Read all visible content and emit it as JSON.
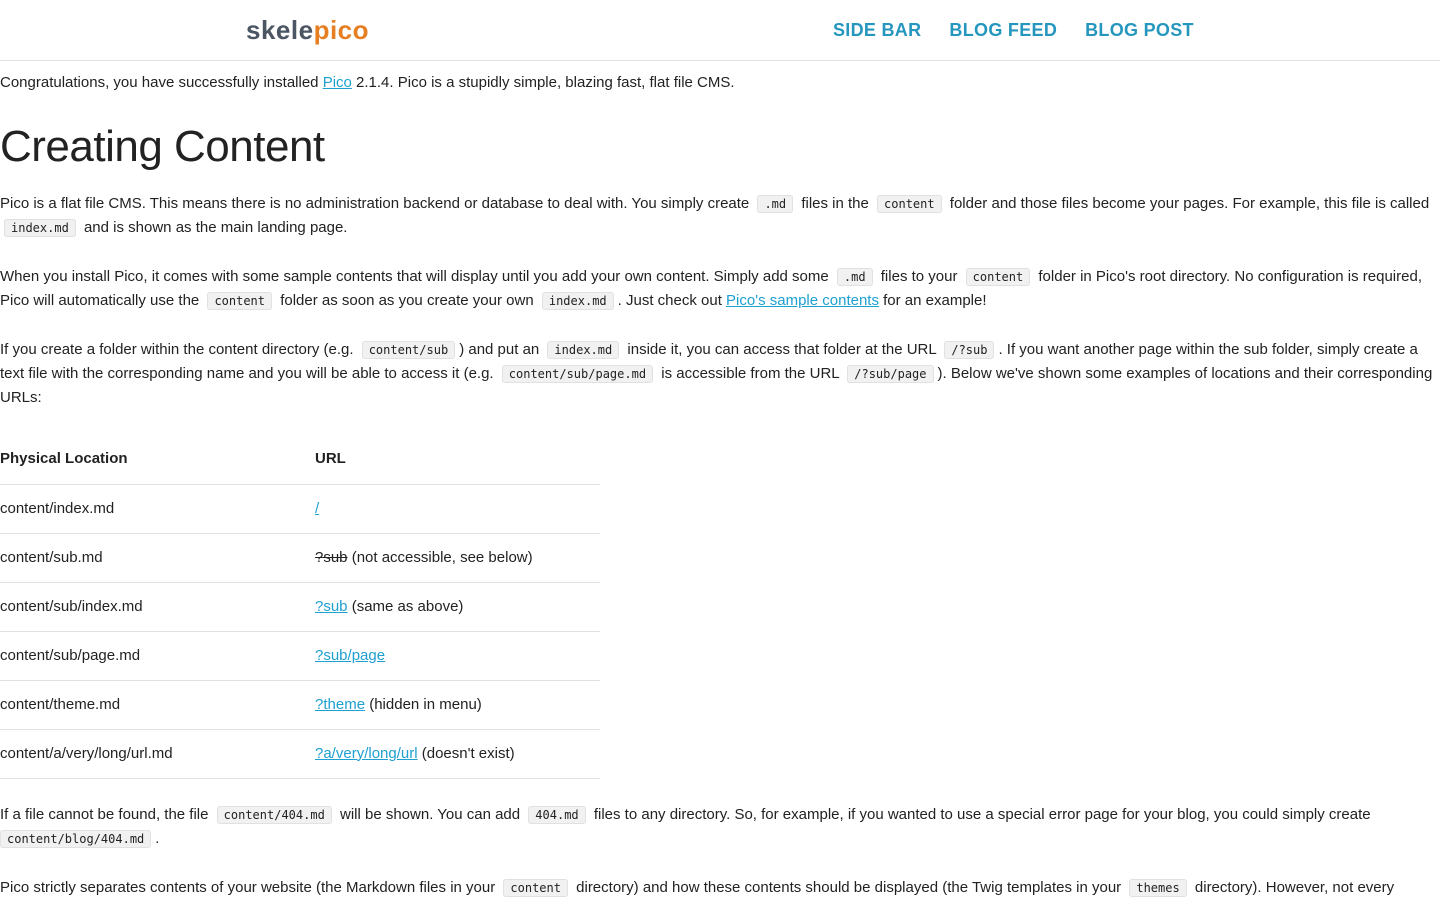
{
  "header": {
    "logo_part1": "skele",
    "logo_part2": "pico",
    "nav": [
      "SIDE BAR",
      "BLOG FEED",
      "BLOG POST"
    ]
  },
  "intro": {
    "pre": "Congratulations, you have successfully installed ",
    "link": "Pico",
    "post": " 2.1.4. Pico is a stupidly simple, blazing fast, flat file CMS."
  },
  "heading": "Creating Content",
  "para1": {
    "t1": "Pico is a flat file CMS. This means there is no administration backend or database to deal with. You simply create",
    "c1": ".md",
    "t2": "files in the",
    "c2": "content",
    "t3": "folder and those files become your pages. For example, this file is called",
    "c3": "index.md",
    "t4": "and is shown as the main landing page."
  },
  "para2": {
    "t1": "When you install Pico, it comes with some sample contents that will display until you add your own content. Simply add some",
    "c1": ".md",
    "t2": "files to your",
    "c2": "content",
    "t3": "folder in Pico's root directory. No configuration is required, Pico will automatically use the",
    "c3": "content",
    "t4": "folder as soon as you create your own",
    "c4": "index.md",
    "t5": ". Just check out",
    "link": "Pico's sample contents",
    "t6": " for an example!"
  },
  "para3": {
    "t1": "If you create a folder within the content directory (e.g.",
    "c1": "content/sub",
    "t2": ") and put an",
    "c2": "index.md",
    "t3": "inside it, you can access that folder at the URL",
    "c3": "/?sub",
    "t4": ". If you want another page within the sub folder, simply create a text file with the corresponding name and you will be able to access it (e.g.",
    "c4": "content/sub/page.md",
    "t5": "is accessible from the URL",
    "c5": "/?sub/page",
    "t6": "). Below we've shown some examples of locations and their corresponding URLs:"
  },
  "table": {
    "headers": [
      "Physical Location",
      "URL"
    ],
    "rows": [
      {
        "location": "content/index.md",
        "url": "/",
        "strike": false,
        "note": ""
      },
      {
        "location": "content/sub.md",
        "url": "?sub",
        "strike": true,
        "note": " (not accessible, see below)"
      },
      {
        "location": "content/sub/index.md",
        "url": "?sub",
        "strike": false,
        "note": " (same as above)"
      },
      {
        "location": "content/sub/page.md",
        "url": "?sub/page",
        "strike": false,
        "note": ""
      },
      {
        "location": "content/theme.md",
        "url": "?theme",
        "strike": false,
        "note": " (hidden in menu)"
      },
      {
        "location": "content/a/very/long/url.md",
        "url": "?a/very/long/url",
        "strike": false,
        "note": " (doesn't exist)"
      }
    ]
  },
  "para4": {
    "t1": "If a file cannot be found, the file",
    "c1": "content/404.md",
    "t2": "will be shown. You can add",
    "c2": "404.md",
    "t3": "files to any directory. So, for example, if you wanted to use a special error page for your blog, you could simply create",
    "c3": "content/blog/404.md",
    "t4": "."
  },
  "para5": {
    "t1": "Pico strictly separates contents of your website (the Markdown files in your",
    "c1": "content",
    "t2": "directory) and how these contents should be displayed (the Twig templates in your",
    "c2": "themes",
    "t3": "directory). However, not every"
  }
}
